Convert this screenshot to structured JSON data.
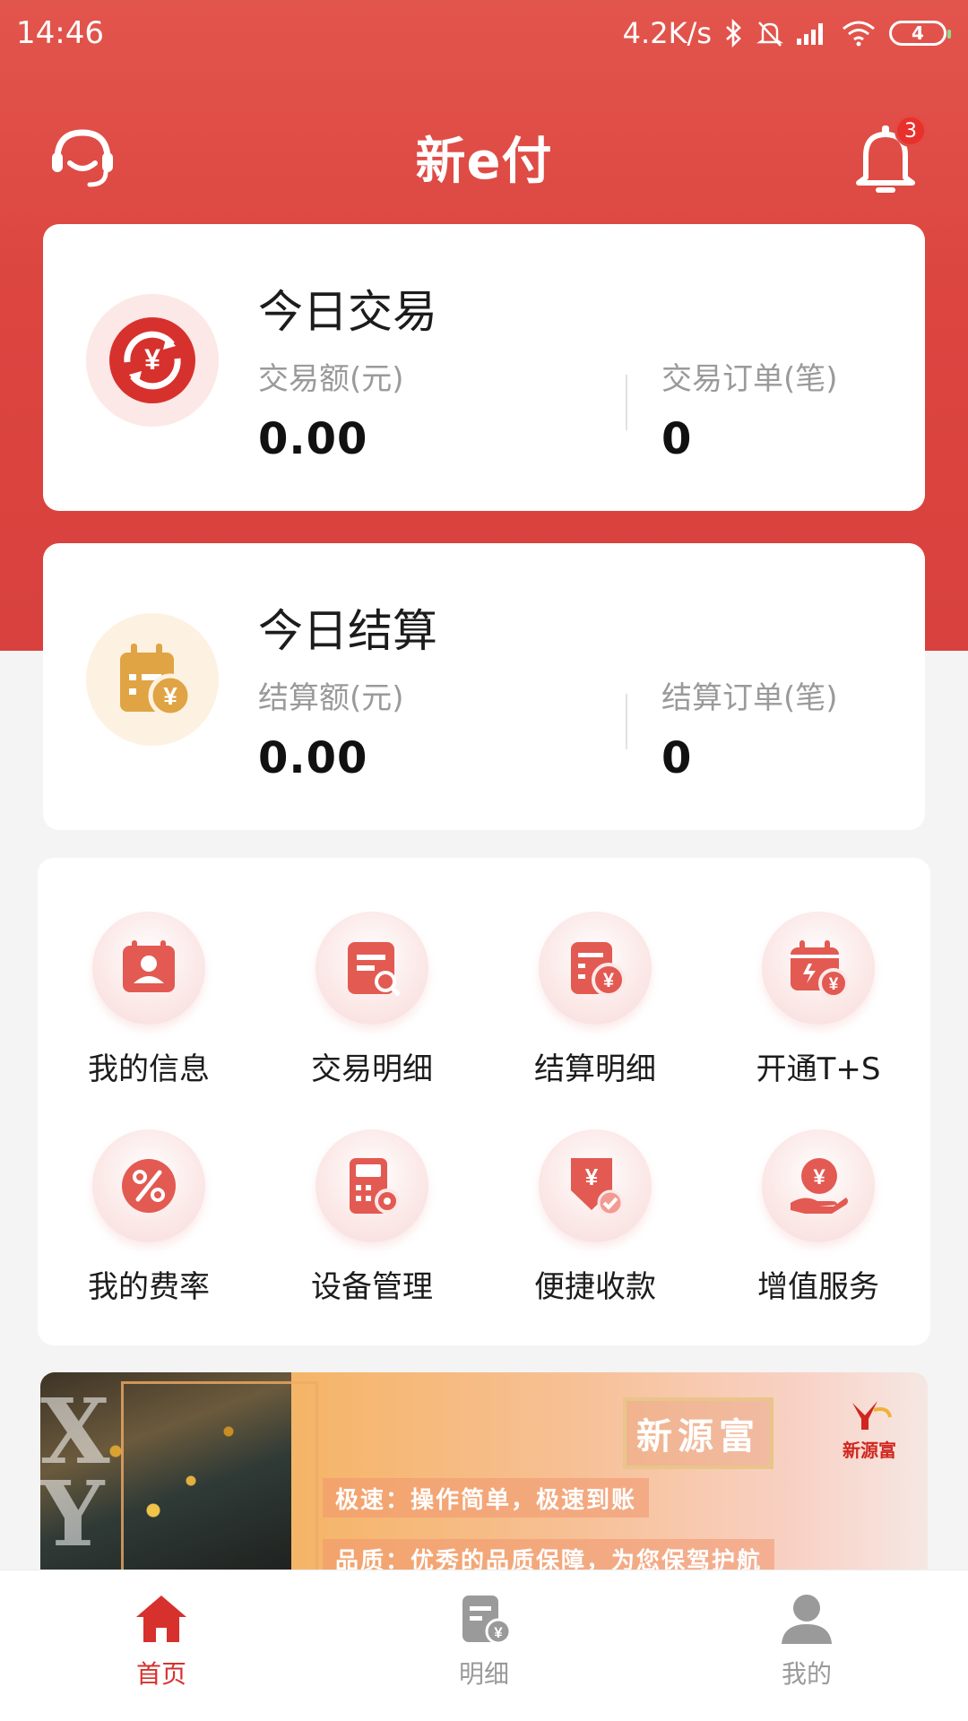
{
  "status_bar": {
    "time": "14:46",
    "net_speed": "4.2K/s",
    "battery_level": "4"
  },
  "header": {
    "title": "新e付",
    "notification_count": "3"
  },
  "today_trade": {
    "title": "今日交易",
    "amount_label": "交易额(元)",
    "amount_value": "0.00",
    "orders_label": "交易订单(笔)",
    "orders_value": "0"
  },
  "today_settle": {
    "title": "今日结算",
    "amount_label": "结算额(元)",
    "amount_value": "0.00",
    "orders_label": "结算订单(笔)",
    "orders_value": "0"
  },
  "menu": {
    "items": [
      {
        "label": "我的信息",
        "icon": "contact-card-icon"
      },
      {
        "label": "交易明细",
        "icon": "receipt-search-icon"
      },
      {
        "label": "结算明细",
        "icon": "document-yen-icon"
      },
      {
        "label": "开通T+S",
        "icon": "calendar-yen-icon"
      },
      {
        "label": "我的费率",
        "icon": "percent-icon"
      },
      {
        "label": "设备管理",
        "icon": "pos-device-icon"
      },
      {
        "label": "便捷收款",
        "icon": "yen-check-icon"
      },
      {
        "label": "增值服务",
        "icon": "hand-coin-icon"
      }
    ]
  },
  "banner": {
    "letters": "XY",
    "brand": "新源富",
    "logo_text": "新源富",
    "line1": "极速：操作简单，极速到账",
    "line2": "品质：优秀的品质保障，为您保驾护航"
  },
  "bottom_nav": {
    "items": [
      {
        "label": "首页",
        "icon": "home-icon",
        "active": true
      },
      {
        "label": "明细",
        "icon": "details-icon",
        "active": false
      },
      {
        "label": "我的",
        "icon": "profile-icon",
        "active": false
      }
    ]
  },
  "colors": {
    "brand_red": "#dc4540",
    "accent_red": "#d7312d",
    "settle_gold": "#e0a444",
    "nav_inactive": "#9a9a9a"
  }
}
